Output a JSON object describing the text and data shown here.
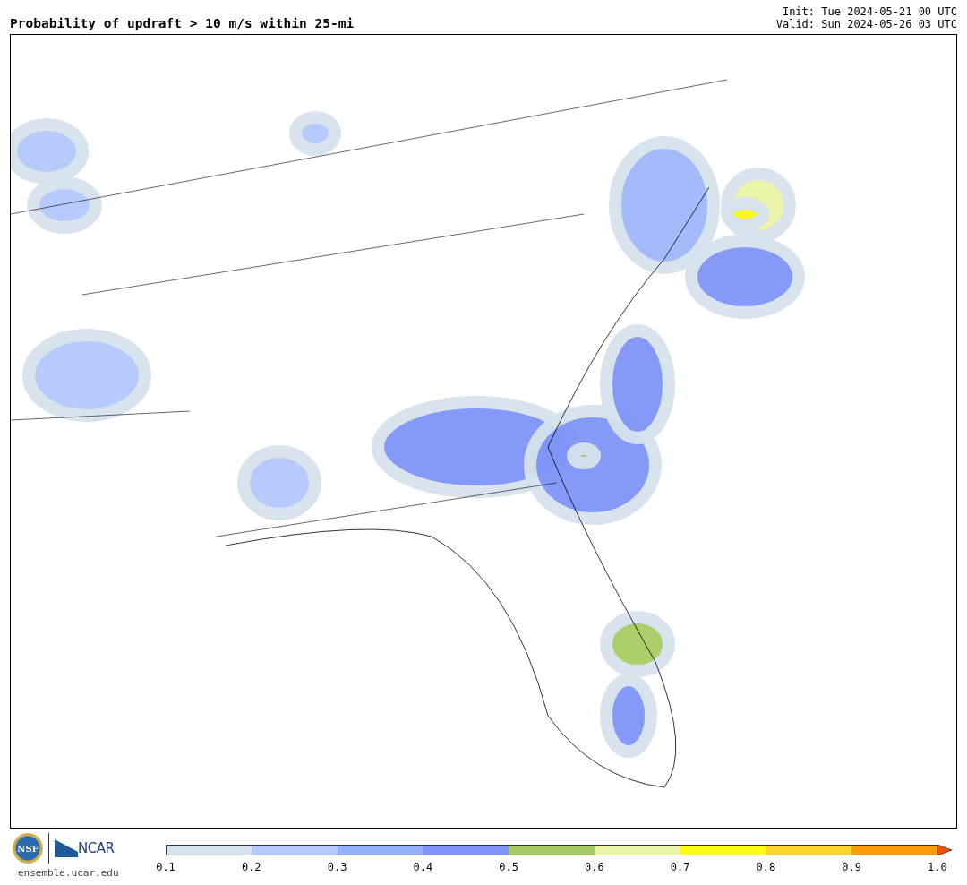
{
  "title": "Probability of updraft > 10 m/s within 25-mi",
  "init": "Init: Tue 2024-05-21 00 UTC",
  "valid": "Valid: Sun 2024-05-26 03 UTC",
  "logos": {
    "nsf": "NSF",
    "ncar": "NCAR",
    "url": "ensemble.ucar.edu"
  },
  "colorbar": {
    "bins": [
      {
        "color": "#d6e2ee"
      },
      {
        "color": "#b4c8fc"
      },
      {
        "color": "#94b0fb"
      },
      {
        "color": "#7e94f8"
      },
      {
        "color": "#a8cc64"
      },
      {
        "color": "#eaf4a4"
      },
      {
        "color": "#fcfc14"
      },
      {
        "color": "#fcd42c"
      },
      {
        "color": "#fc9c0c"
      }
    ],
    "overflow": {
      "color": "#f0500c"
    },
    "ticks": [
      "0.1",
      "0.2",
      "0.3",
      "0.4",
      "0.5",
      "0.6",
      "0.7",
      "0.8",
      "0.9",
      "1.0"
    ]
  }
}
